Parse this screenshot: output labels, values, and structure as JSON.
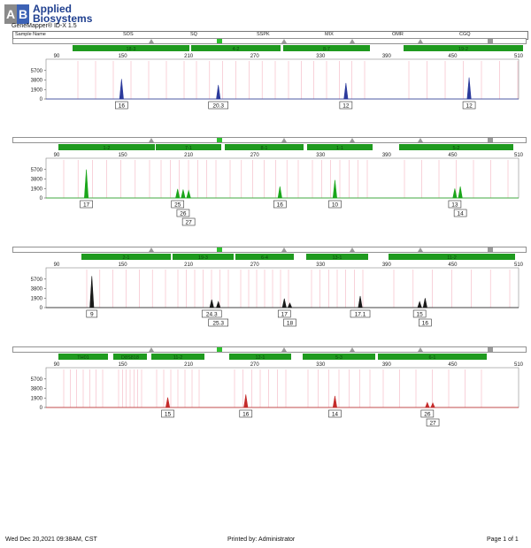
{
  "header": {
    "brand_line1": "Applied",
    "brand_line2": "Biosystems",
    "product": "GeneMapper® ID-X  1.5",
    "columns": [
      "Sample Name",
      "SOS",
      "SQ",
      "SSPK",
      "MIX",
      "OMR",
      "CGQ"
    ]
  },
  "footer": {
    "date": "Wed Dec 20,2021 09:38AM, CST",
    "printed_by": "Printed by: Administrator",
    "page": "Page 1 of 1"
  },
  "chart_data": [
    {
      "type": "line",
      "color": "#2b3a9c",
      "xlim": [
        90,
        510
      ],
      "x_ticks": [
        90,
        150,
        210,
        270,
        330,
        390,
        450,
        510
      ],
      "y_ticks": [
        0,
        1900,
        3800,
        5700
      ],
      "ylim": [
        0,
        7600
      ],
      "markers": [
        "18-3",
        "4-2",
        "8-7",
        "19-2"
      ],
      "peaks": [
        {
          "x": 149,
          "height": 4000,
          "label": "16"
        },
        {
          "x": 237,
          "height": 2800,
          "label": "20.3"
        },
        {
          "x": 353,
          "height": 3200,
          "label": "12"
        },
        {
          "x": 465,
          "height": 4300,
          "label": "12"
        }
      ]
    },
    {
      "type": "line",
      "color": "#1aa61a",
      "xlim": [
        90,
        510
      ],
      "x_ticks": [
        90,
        150,
        210,
        270,
        330,
        390,
        450,
        510
      ],
      "y_ticks": [
        0,
        1900,
        3800,
        5700
      ],
      "ylim": [
        0,
        7600
      ],
      "markers": [
        "1-2",
        "7-1",
        "8-1",
        "1-1",
        "5-2"
      ],
      "peaks": [
        {
          "x": 117,
          "height": 5700,
          "label": "17"
        },
        {
          "x": 200,
          "height": 1800,
          "label": "25"
        },
        {
          "x": 205,
          "height": 1700,
          "label": "26"
        },
        {
          "x": 210,
          "height": 1500,
          "label": "27"
        },
        {
          "x": 293,
          "height": 2300,
          "label": "16"
        },
        {
          "x": 343,
          "height": 3600,
          "label": "10"
        },
        {
          "x": 452,
          "height": 1900,
          "label": "13"
        },
        {
          "x": 457,
          "height": 2300,
          "label": "14"
        }
      ]
    },
    {
      "type": "line",
      "color": "#1a1a1a",
      "xlim": [
        90,
        510
      ],
      "x_ticks": [
        90,
        150,
        210,
        270,
        330,
        390,
        450,
        510
      ],
      "y_ticks": [
        0,
        1900,
        3800,
        5700
      ],
      "ylim": [
        0,
        7600
      ],
      "markers": [
        "2-1",
        "19-3",
        "6-4",
        "13-1",
        "11-2"
      ],
      "peaks": [
        {
          "x": 122,
          "height": 6300,
          "label": "9"
        },
        {
          "x": 231,
          "height": 1600,
          "label": "24.3"
        },
        {
          "x": 237,
          "height": 1200,
          "label": "25.3"
        },
        {
          "x": 297,
          "height": 1800,
          "label": "17"
        },
        {
          "x": 302,
          "height": 900,
          "label": "18"
        },
        {
          "x": 366,
          "height": 2300,
          "label": "17.1"
        },
        {
          "x": 420,
          "height": 1200,
          "label": "15"
        },
        {
          "x": 425,
          "height": 1900,
          "label": "16"
        }
      ]
    },
    {
      "type": "line",
      "color": "#c42a2a",
      "xlim": [
        90,
        510
      ],
      "x_ticks": [
        90,
        150,
        210,
        270,
        330,
        390,
        450,
        510
      ],
      "y_ticks": [
        0,
        1900,
        3800,
        5700
      ],
      "ylim": [
        0,
        7600
      ],
      "markers": [
        "TH01",
        "D8S818",
        "11-2",
        "12-1",
        "5-3",
        "6-1"
      ],
      "peaks": [
        {
          "x": 191,
          "height": 2000,
          "label": "15"
        },
        {
          "x": 262,
          "height": 2600,
          "label": "16"
        },
        {
          "x": 343,
          "height": 2300,
          "label": "14"
        },
        {
          "x": 427,
          "height": 1000,
          "label": "26"
        },
        {
          "x": 432,
          "height": 900,
          "label": "27"
        }
      ]
    }
  ]
}
